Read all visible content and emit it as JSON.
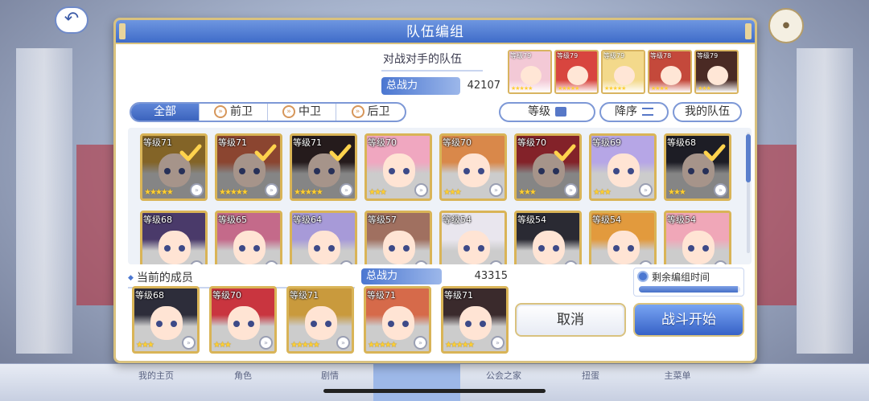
{
  "background": {
    "nav": [
      "我的主页",
      "角色",
      "剧情",
      "",
      "公会之家",
      "扭蛋",
      "主菜单"
    ]
  },
  "modal": {
    "title": "队伍编组",
    "opponent": {
      "title": "对战对手的队伍",
      "power_label": "总战力",
      "power_value": "42107",
      "team": [
        {
          "level": "等级79",
          "hair": "#f3c9d6",
          "stars": "★★★★★"
        },
        {
          "level": "等级79",
          "hair": "#d8453f",
          "stars": "★★★★★"
        },
        {
          "level": "等级79",
          "hair": "#f3d98b",
          "stars": "★★★★★"
        },
        {
          "level": "等级78",
          "hair": "#c4493b",
          "stars": "★★★★"
        },
        {
          "level": "等级79",
          "hair": "#4a2a24",
          "stars": "★★★"
        }
      ]
    },
    "filters": {
      "tabs": [
        {
          "label": "全部",
          "icon": ""
        },
        {
          "label": "前卫",
          "icon": "»"
        },
        {
          "label": "中卫",
          "icon": "»"
        },
        {
          "label": "后卫",
          "icon": "»"
        }
      ],
      "level_btn": "等级",
      "sort_btn": "降序",
      "my_team_btn": "我的队伍"
    },
    "roster": [
      [
        {
          "level": "等级71",
          "hair": "#c99a3d",
          "stars": "★★★★★",
          "selected": true
        },
        {
          "level": "等级71",
          "hair": "#d66a4a",
          "stars": "★★★★★",
          "selected": true
        },
        {
          "level": "等级71",
          "hair": "#3a2a2c",
          "stars": "★★★★★",
          "selected": true
        },
        {
          "level": "等级70",
          "hair": "#f0a7c0",
          "stars": "★★★",
          "selected": false
        },
        {
          "level": "等级70",
          "hair": "#d9884a",
          "stars": "★★★",
          "selected": false
        },
        {
          "level": "等级70",
          "hair": "#c9353f",
          "stars": "★★★",
          "selected": true
        },
        {
          "level": "等级69",
          "hair": "#b6a6e6",
          "stars": "★★★",
          "selected": false
        },
        {
          "level": "等级68",
          "hair": "#2d2d3a",
          "stars": "★★★",
          "selected": true
        }
      ],
      [
        {
          "level": "等级68",
          "hair": "#4a3a6a",
          "stars": "★★★",
          "selected": false
        },
        {
          "level": "等级65",
          "hair": "#c46a8a",
          "stars": "★★★",
          "selected": false
        },
        {
          "level": "等级64",
          "hair": "#a79ad8",
          "stars": "★★★",
          "selected": false
        },
        {
          "level": "等级57",
          "hair": "#a07060",
          "stars": "★★★",
          "selected": false
        },
        {
          "level": "等级54",
          "hair": "#e9e6ee",
          "stars": "★★★",
          "selected": false
        },
        {
          "level": "等级54",
          "hair": "#2a2a33",
          "stars": "★★★",
          "selected": false
        },
        {
          "level": "等级54",
          "hair": "#e29a3d",
          "stars": "★★★",
          "selected": false
        },
        {
          "level": "等级54",
          "hair": "#f0a7b8",
          "stars": "★★★",
          "selected": false
        }
      ]
    ],
    "members": {
      "title": "当前的成员",
      "power_label": "总战力",
      "power_value": "43315",
      "team": [
        {
          "level": "等级68",
          "hair": "#2d2d3a",
          "stars": "★★★"
        },
        {
          "level": "等级70",
          "hair": "#c9353f",
          "stars": "★★★"
        },
        {
          "level": "等级71",
          "hair": "#c99a3d",
          "stars": "★★★★★"
        },
        {
          "level": "等级71",
          "hair": "#d66a4a",
          "stars": "★★★★★"
        },
        {
          "level": "等级71",
          "hair": "#3a2a2c",
          "stars": "★★★★★"
        }
      ]
    },
    "timer": {
      "label": "剩余编组时间",
      "remaining_fraction": 0.98
    },
    "cancel": "取消",
    "start": "战斗开始"
  }
}
